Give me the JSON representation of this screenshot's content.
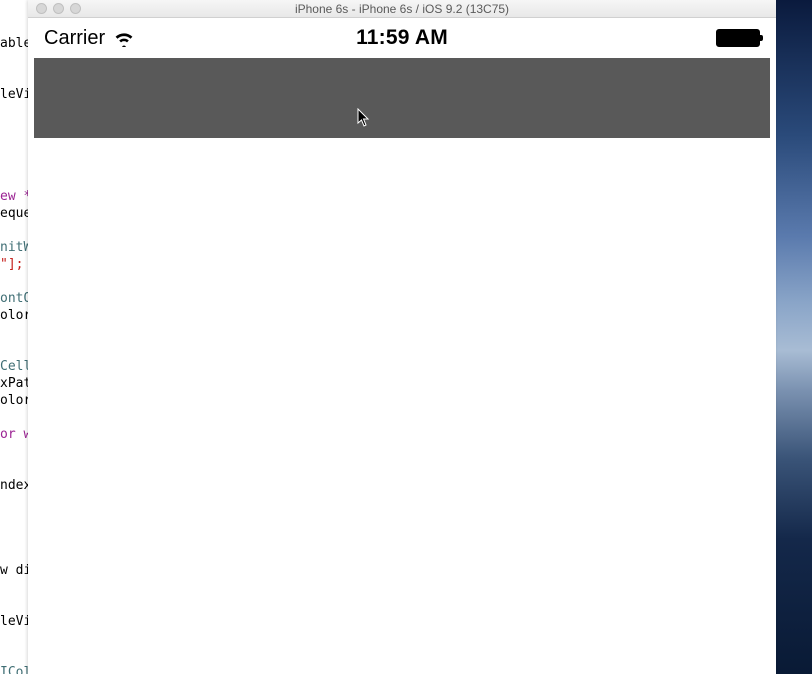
{
  "desktop": {},
  "xcode": {
    "fragments": [
      {
        "cls": "black",
        "text": "ableVi"
      },
      {
        "cls": "",
        "text": ""
      },
      {
        "cls": "",
        "text": ""
      },
      {
        "cls": "black",
        "text": "leVi"
      },
      {
        "cls": "",
        "text": ""
      },
      {
        "cls": "",
        "text": ""
      },
      {
        "cls": "",
        "text": ""
      },
      {
        "cls": "",
        "text": ""
      },
      {
        "cls": "",
        "text": ""
      },
      {
        "cls": "purple",
        "text": "ew *"
      },
      {
        "cls": "black",
        "text": "eque"
      },
      {
        "cls": "",
        "text": ""
      },
      {
        "cls": "teal",
        "text": "nitW"
      },
      {
        "cls": "red",
        "text": "\"];"
      },
      {
        "cls": "",
        "text": ""
      },
      {
        "cls": "teal",
        "text": "ontO"
      },
      {
        "cls": "black",
        "text": "olor"
      },
      {
        "cls": "",
        "text": ""
      },
      {
        "cls": "",
        "text": ""
      },
      {
        "cls": "teal",
        "text": "Cell"
      },
      {
        "cls": "black",
        "text": "xPat"
      },
      {
        "cls": "black",
        "text": "olor"
      },
      {
        "cls": "",
        "text": ""
      },
      {
        "cls": "purple",
        "text": "or w"
      },
      {
        "cls": "",
        "text": ""
      },
      {
        "cls": "",
        "text": ""
      },
      {
        "cls": "black",
        "text": "ndex"
      },
      {
        "cls": "",
        "text": ""
      },
      {
        "cls": "",
        "text": ""
      },
      {
        "cls": "",
        "text": ""
      },
      {
        "cls": "",
        "text": ""
      },
      {
        "cls": "black",
        "text": "w di"
      },
      {
        "cls": "",
        "text": ""
      },
      {
        "cls": "",
        "text": ""
      },
      {
        "cls": "black",
        "text": "leVi"
      },
      {
        "cls": "",
        "text": ""
      },
      {
        "cls": "",
        "text": ""
      },
      {
        "cls": "teal",
        "text": "ICol"
      }
    ]
  },
  "simulator": {
    "titlebar": "iPhone 6s - iPhone 6s / iOS 9.2 (13C75)",
    "statusbar": {
      "carrier": "Carrier",
      "time": "11:59 AM"
    }
  }
}
